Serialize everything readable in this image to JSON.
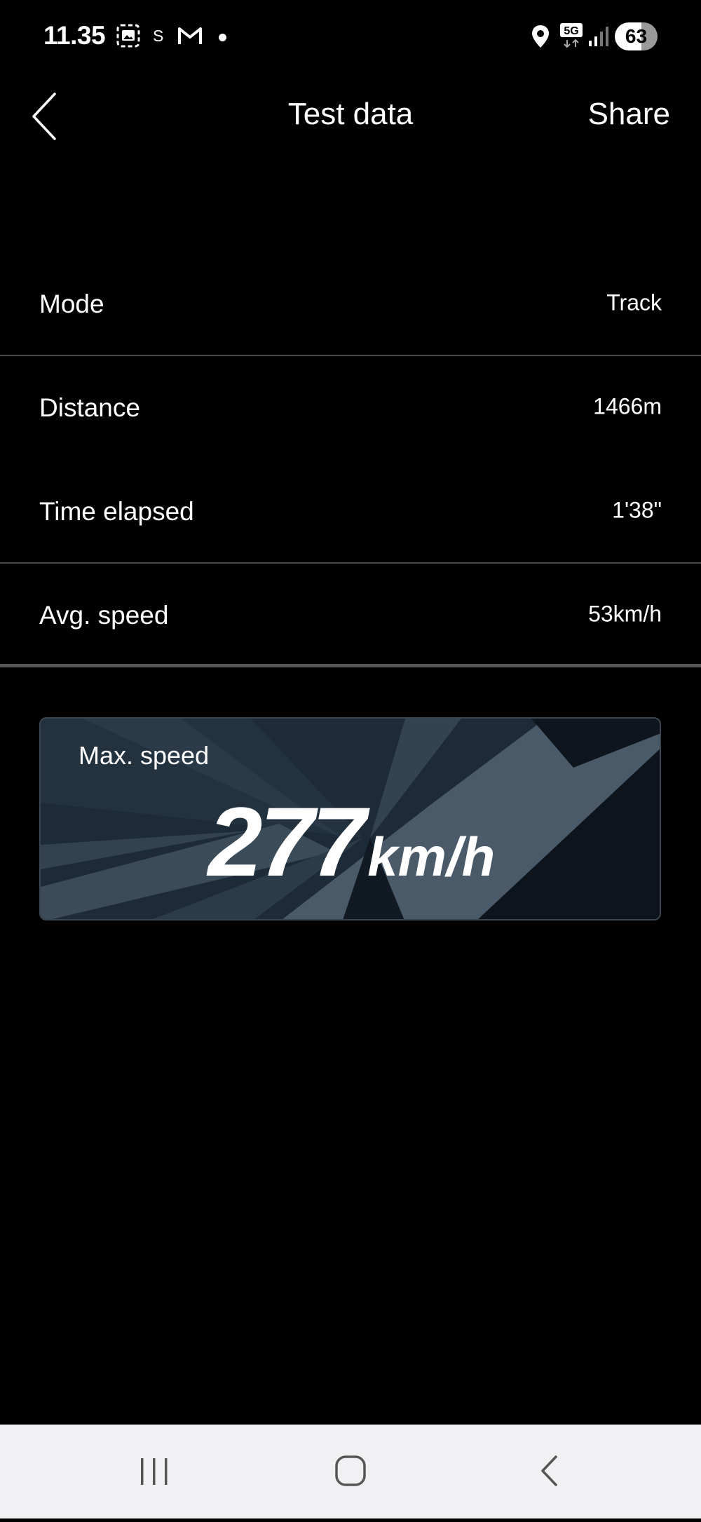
{
  "status_bar": {
    "time": "11.35",
    "s_label": "S",
    "network": "5G",
    "battery": "63"
  },
  "header": {
    "title": "Test data",
    "share_label": "Share"
  },
  "rows": [
    {
      "label": "Mode",
      "value": "Track"
    },
    {
      "label": "Distance",
      "value": "1466m"
    },
    {
      "label": "Time elapsed",
      "value": "1'38\""
    },
    {
      "label": "Avg. speed",
      "value": "53km/h"
    }
  ],
  "max_speed": {
    "label": "Max. speed",
    "value": "277",
    "unit": "km/h"
  },
  "icons": {
    "back": "chevron-left-icon",
    "gallery": "image-icon",
    "gmail": "gmail-icon",
    "location": "location-pin-icon",
    "signal": "signal-bars-icon",
    "nav_recents": "recents-icon",
    "nav_home": "home-icon",
    "nav_back": "nav-back-icon"
  },
  "colors": {
    "background": "#000000",
    "card_background": "#1f2f3d",
    "nav_bar": "#f1f1f3"
  }
}
